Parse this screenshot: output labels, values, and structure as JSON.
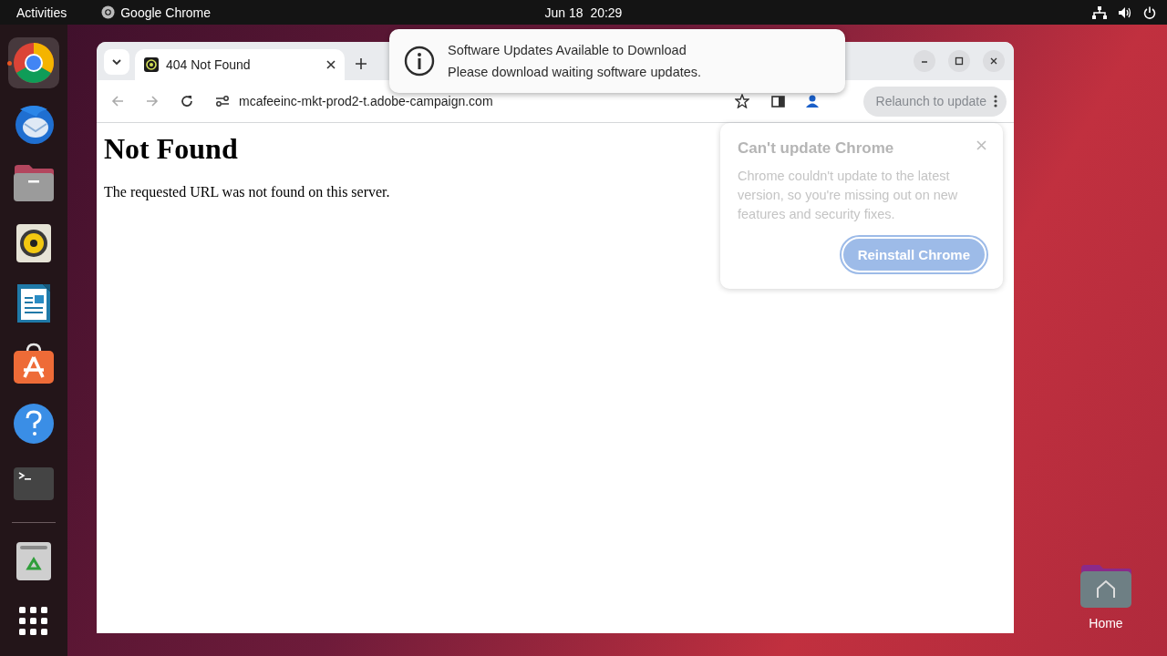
{
  "top_bar": {
    "activities": "Activities",
    "app_name": "Google Chrome",
    "clock": "Jun 18  20:29"
  },
  "dock": {
    "items": [
      {
        "kind": "chrome",
        "selected": true
      },
      {
        "kind": "mail",
        "selected": false
      },
      {
        "kind": "files",
        "selected": false
      },
      {
        "kind": "music",
        "selected": false
      },
      {
        "kind": "writer",
        "selected": false
      },
      {
        "kind": "store",
        "selected": false
      },
      {
        "kind": "help",
        "selected": false
      },
      {
        "kind": "terminal",
        "selected": false
      }
    ],
    "trash": {
      "kind": "trash"
    },
    "apps": {
      "kind": "grid"
    }
  },
  "browser": {
    "tabs": [
      {
        "title": "404 Not Found",
        "selected": true
      }
    ],
    "url": "mcafeeinc-mkt-prod2-t.adobe-campaign.com",
    "relaunch_button": "Relaunch to update",
    "page": {
      "heading": "Not Found",
      "text": "The requested URL was not found on this server."
    },
    "update_popup": {
      "title": "Can't update Chrome",
      "body": "Chrome couldn't update to the latest version, so you're missing out on new features and security fixes.",
      "button": "Reinstall Chrome"
    }
  },
  "notification": {
    "title": "Software Updates Available to Download",
    "body": "Please download waiting software updates."
  },
  "desktop_icons": [
    {
      "label": "Home"
    }
  ]
}
